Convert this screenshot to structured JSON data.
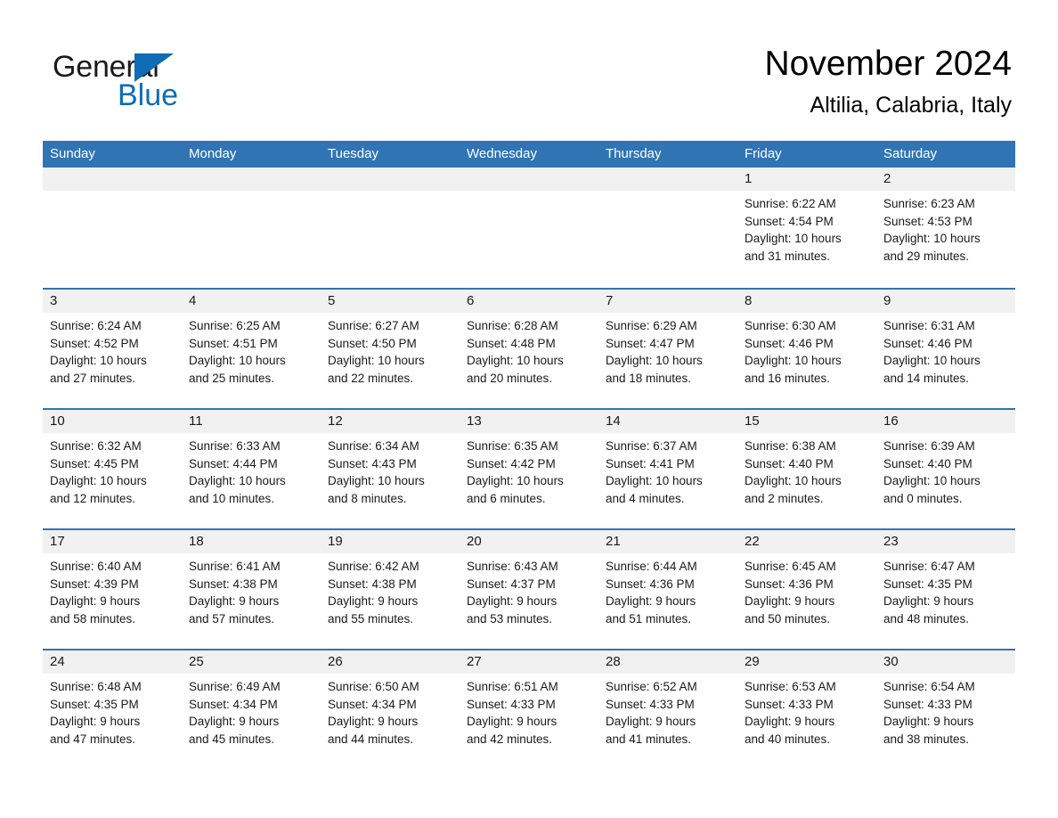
{
  "brand": {
    "name_part1": "General",
    "name_part2": "Blue",
    "triangle_icon": "triangle-icon",
    "accent_color": "#0f6cb5"
  },
  "header": {
    "title": "November 2024",
    "subtitle": "Altilia, Calabria, Italy"
  },
  "theme": {
    "header_blue": "#3174b4",
    "day_band_gray": "#f1f1f1",
    "text_black": "#1a1a1a"
  },
  "calendar": {
    "weekday_headers": [
      "Sunday",
      "Monday",
      "Tuesday",
      "Wednesday",
      "Thursday",
      "Friday",
      "Saturday"
    ],
    "weeks": [
      [
        {
          "day": "",
          "lines": []
        },
        {
          "day": "",
          "lines": []
        },
        {
          "day": "",
          "lines": []
        },
        {
          "day": "",
          "lines": []
        },
        {
          "day": "",
          "lines": []
        },
        {
          "day": "1",
          "lines": [
            "Sunrise: 6:22 AM",
            "Sunset: 4:54 PM",
            "Daylight: 10 hours",
            "and 31 minutes."
          ]
        },
        {
          "day": "2",
          "lines": [
            "Sunrise: 6:23 AM",
            "Sunset: 4:53 PM",
            "Daylight: 10 hours",
            "and 29 minutes."
          ]
        }
      ],
      [
        {
          "day": "3",
          "lines": [
            "Sunrise: 6:24 AM",
            "Sunset: 4:52 PM",
            "Daylight: 10 hours",
            "and 27 minutes."
          ]
        },
        {
          "day": "4",
          "lines": [
            "Sunrise: 6:25 AM",
            "Sunset: 4:51 PM",
            "Daylight: 10 hours",
            "and 25 minutes."
          ]
        },
        {
          "day": "5",
          "lines": [
            "Sunrise: 6:27 AM",
            "Sunset: 4:50 PM",
            "Daylight: 10 hours",
            "and 22 minutes."
          ]
        },
        {
          "day": "6",
          "lines": [
            "Sunrise: 6:28 AM",
            "Sunset: 4:48 PM",
            "Daylight: 10 hours",
            "and 20 minutes."
          ]
        },
        {
          "day": "7",
          "lines": [
            "Sunrise: 6:29 AM",
            "Sunset: 4:47 PM",
            "Daylight: 10 hours",
            "and 18 minutes."
          ]
        },
        {
          "day": "8",
          "lines": [
            "Sunrise: 6:30 AM",
            "Sunset: 4:46 PM",
            "Daylight: 10 hours",
            "and 16 minutes."
          ]
        },
        {
          "day": "9",
          "lines": [
            "Sunrise: 6:31 AM",
            "Sunset: 4:46 PM",
            "Daylight: 10 hours",
            "and 14 minutes."
          ]
        }
      ],
      [
        {
          "day": "10",
          "lines": [
            "Sunrise: 6:32 AM",
            "Sunset: 4:45 PM",
            "Daylight: 10 hours",
            "and 12 minutes."
          ]
        },
        {
          "day": "11",
          "lines": [
            "Sunrise: 6:33 AM",
            "Sunset: 4:44 PM",
            "Daylight: 10 hours",
            "and 10 minutes."
          ]
        },
        {
          "day": "12",
          "lines": [
            "Sunrise: 6:34 AM",
            "Sunset: 4:43 PM",
            "Daylight: 10 hours",
            "and 8 minutes."
          ]
        },
        {
          "day": "13",
          "lines": [
            "Sunrise: 6:35 AM",
            "Sunset: 4:42 PM",
            "Daylight: 10 hours",
            "and 6 minutes."
          ]
        },
        {
          "day": "14",
          "lines": [
            "Sunrise: 6:37 AM",
            "Sunset: 4:41 PM",
            "Daylight: 10 hours",
            "and 4 minutes."
          ]
        },
        {
          "day": "15",
          "lines": [
            "Sunrise: 6:38 AM",
            "Sunset: 4:40 PM",
            "Daylight: 10 hours",
            "and 2 minutes."
          ]
        },
        {
          "day": "16",
          "lines": [
            "Sunrise: 6:39 AM",
            "Sunset: 4:40 PM",
            "Daylight: 10 hours",
            "and 0 minutes."
          ]
        }
      ],
      [
        {
          "day": "17",
          "lines": [
            "Sunrise: 6:40 AM",
            "Sunset: 4:39 PM",
            "Daylight: 9 hours",
            "and 58 minutes."
          ]
        },
        {
          "day": "18",
          "lines": [
            "Sunrise: 6:41 AM",
            "Sunset: 4:38 PM",
            "Daylight: 9 hours",
            "and 57 minutes."
          ]
        },
        {
          "day": "19",
          "lines": [
            "Sunrise: 6:42 AM",
            "Sunset: 4:38 PM",
            "Daylight: 9 hours",
            "and 55 minutes."
          ]
        },
        {
          "day": "20",
          "lines": [
            "Sunrise: 6:43 AM",
            "Sunset: 4:37 PM",
            "Daylight: 9 hours",
            "and 53 minutes."
          ]
        },
        {
          "day": "21",
          "lines": [
            "Sunrise: 6:44 AM",
            "Sunset: 4:36 PM",
            "Daylight: 9 hours",
            "and 51 minutes."
          ]
        },
        {
          "day": "22",
          "lines": [
            "Sunrise: 6:45 AM",
            "Sunset: 4:36 PM",
            "Daylight: 9 hours",
            "and 50 minutes."
          ]
        },
        {
          "day": "23",
          "lines": [
            "Sunrise: 6:47 AM",
            "Sunset: 4:35 PM",
            "Daylight: 9 hours",
            "and 48 minutes."
          ]
        }
      ],
      [
        {
          "day": "24",
          "lines": [
            "Sunrise: 6:48 AM",
            "Sunset: 4:35 PM",
            "Daylight: 9 hours",
            "and 47 minutes."
          ]
        },
        {
          "day": "25",
          "lines": [
            "Sunrise: 6:49 AM",
            "Sunset: 4:34 PM",
            "Daylight: 9 hours",
            "and 45 minutes."
          ]
        },
        {
          "day": "26",
          "lines": [
            "Sunrise: 6:50 AM",
            "Sunset: 4:34 PM",
            "Daylight: 9 hours",
            "and 44 minutes."
          ]
        },
        {
          "day": "27",
          "lines": [
            "Sunrise: 6:51 AM",
            "Sunset: 4:33 PM",
            "Daylight: 9 hours",
            "and 42 minutes."
          ]
        },
        {
          "day": "28",
          "lines": [
            "Sunrise: 6:52 AM",
            "Sunset: 4:33 PM",
            "Daylight: 9 hours",
            "and 41 minutes."
          ]
        },
        {
          "day": "29",
          "lines": [
            "Sunrise: 6:53 AM",
            "Sunset: 4:33 PM",
            "Daylight: 9 hours",
            "and 40 minutes."
          ]
        },
        {
          "day": "30",
          "lines": [
            "Sunrise: 6:54 AM",
            "Sunset: 4:33 PM",
            "Daylight: 9 hours",
            "and 38 minutes."
          ]
        }
      ]
    ]
  }
}
